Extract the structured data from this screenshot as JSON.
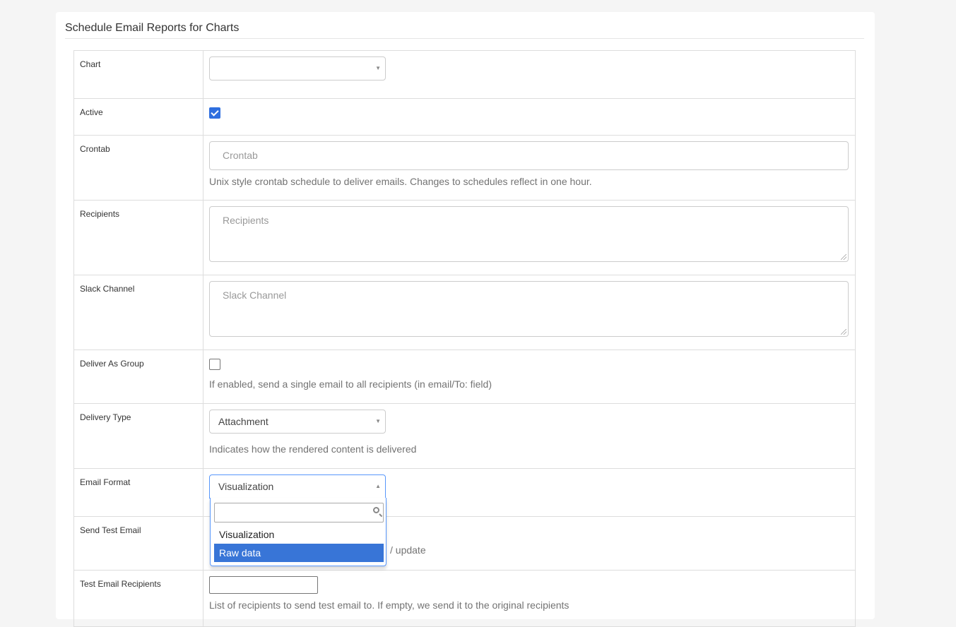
{
  "panel": {
    "title": "Schedule Email Reports for Charts"
  },
  "form": {
    "chart": {
      "label": "Chart",
      "value": ""
    },
    "active": {
      "label": "Active",
      "checked": true
    },
    "crontab": {
      "label": "Crontab",
      "placeholder": "Crontab",
      "help": "Unix style crontab schedule to deliver emails. Changes to schedules reflect in one hour."
    },
    "recipients": {
      "label": "Recipients",
      "placeholder": "Recipients"
    },
    "slack_channel": {
      "label": "Slack Channel",
      "placeholder": "Slack Channel"
    },
    "deliver_as_group": {
      "label": "Deliver As Group",
      "checked": false,
      "help": "If enabled, send a single email to all recipients (in email/To: field)"
    },
    "delivery_type": {
      "label": "Delivery Type",
      "value": "Attachment",
      "help": "Indicates how the rendered content is delivered"
    },
    "email_format": {
      "label": "Email Format",
      "value": "Visualization",
      "options": [
        "Visualization",
        "Raw data"
      ],
      "highlighted": "Raw data"
    },
    "send_test_email": {
      "label": "Send Test Email",
      "help_visible_fragment": "/ update"
    },
    "test_email_recipients": {
      "label": "Test Email Recipients",
      "help": "List of recipients to send test email to. If empty, we send it to the original recipients"
    }
  },
  "colors": {
    "accent": "#2f6fdf",
    "focus_border": "#5897fb",
    "highlight": "#3875d7"
  }
}
